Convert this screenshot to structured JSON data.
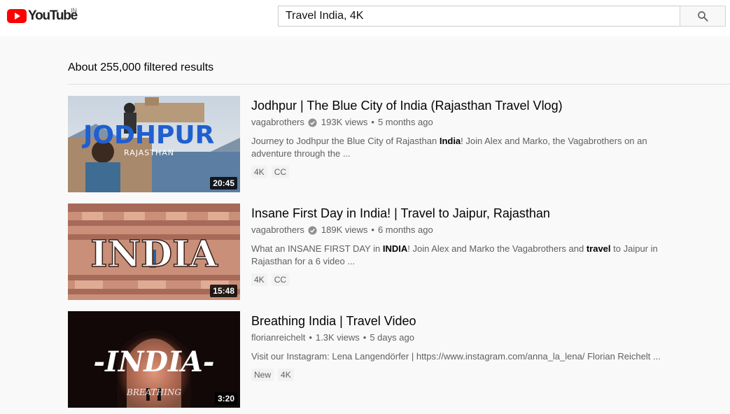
{
  "header": {
    "logo_text": "YouTube",
    "country_code": "IN",
    "search_query": "Travel India, 4K",
    "search_icon": "search-icon",
    "brand_color": "#ff0000"
  },
  "results_summary": "About 255,000 filtered results",
  "results": [
    {
      "title": "Jodhpur | The Blue City of India (Rajasthan Travel Vlog)",
      "channel": "vagabrothers",
      "verified": true,
      "views": "193K views",
      "age": "5 months ago",
      "description_parts": [
        "Journey to Jodhpur the Blue City of Rajasthan ",
        "India",
        "! Join Alex and Marko, the Vagabrothers on an adventure through the ..."
      ],
      "badges": [
        "4K",
        "CC"
      ],
      "duration": "20:45",
      "thumb_text": "JODHPUR",
      "thumb_subtext": "RAJASTHAN"
    },
    {
      "title": "Insane First Day in India! | Travel to Jaipur, Rajasthan",
      "channel": "vagabrothers",
      "verified": true,
      "views": "189K views",
      "age": "6 months ago",
      "description_parts": [
        "What an INSANE FIRST DAY in ",
        "INDIA",
        "! Join Alex and Marko the Vagabrothers and ",
        "travel",
        " to Jaipur in Rajasthan for a 6 video ..."
      ],
      "badges": [
        "4K",
        "CC"
      ],
      "duration": "15:48",
      "thumb_text": "INDIA"
    },
    {
      "title": "Breathing India | Travel Video",
      "channel": "florianreichelt",
      "verified": false,
      "views": "1.3K views",
      "age": "5 days ago",
      "description_parts": [
        "Visit our Instagram: Lena Langendörfer | https://www.instagram.com/anna_la_lena/ Florian Reichelt ..."
      ],
      "badges": [
        "New",
        "4K"
      ],
      "duration": "3:20",
      "thumb_text": "-INDIA-",
      "thumb_subtext": "BREATHING"
    }
  ]
}
